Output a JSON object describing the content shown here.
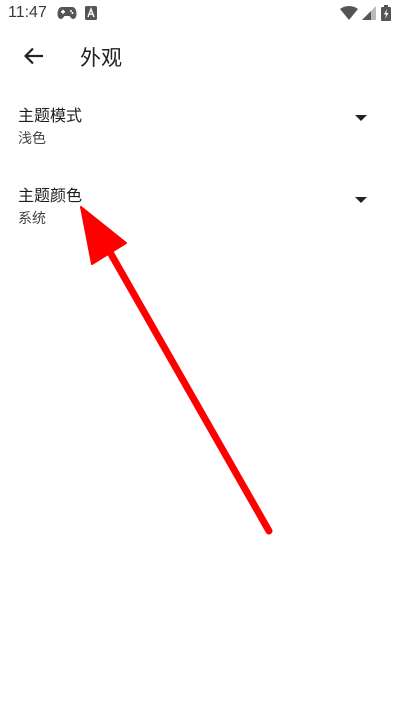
{
  "status_bar": {
    "time": "11:47",
    "icons": [
      "game-controller-icon",
      "a-notification-icon",
      "wifi-icon",
      "cell-signal-icon",
      "battery-icon"
    ]
  },
  "app_bar": {
    "back_icon": "arrow-left-icon",
    "title": "外观"
  },
  "settings": [
    {
      "label": "主题模式",
      "value": "浅色",
      "icon": "dropdown-arrow-icon"
    },
    {
      "label": "主题颜色",
      "value": "系统",
      "icon": "dropdown-arrow-icon"
    }
  ],
  "colors": {
    "annotation_arrow": "#ff0000",
    "text_primary": "#1c1c1c",
    "text_secondary": "#444444"
  }
}
